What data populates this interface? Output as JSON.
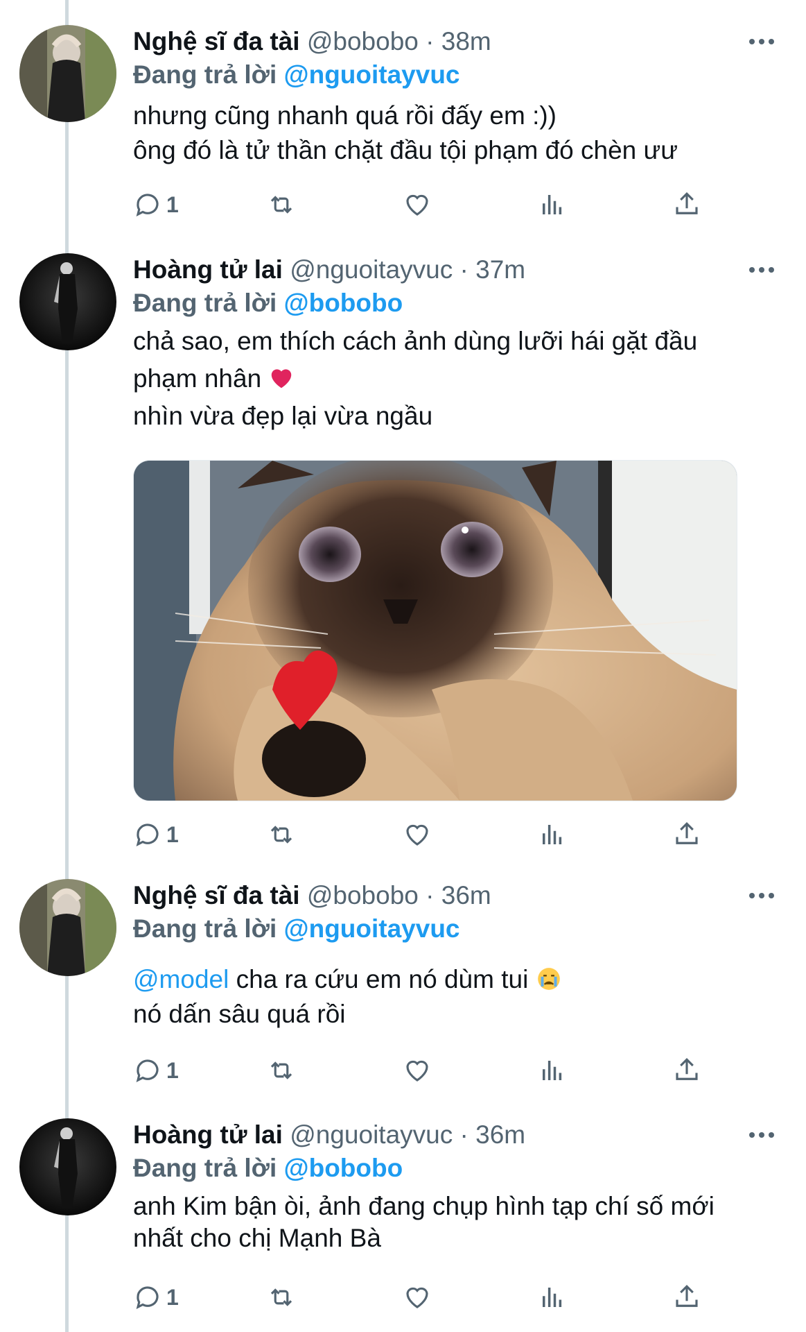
{
  "tweets": [
    {
      "name": "Nghệ sĩ đa tài",
      "handle": "@bobobo",
      "time": "38m",
      "reply_prefix": "Đang trả lời",
      "reply_to": "@nguoitayvuc",
      "lines": [
        "nhưng cũng nhanh quá rồi đấy em :))",
        "ông đó là tử thần chặt đầu tội phạm đó chèn ưư"
      ],
      "reply_count": "1"
    },
    {
      "name": "Hoàng tử lai",
      "handle": "@nguoitayvuc",
      "time": "37m",
      "reply_prefix": "Đang trả lời",
      "reply_to": "@bobobo",
      "lines": [
        "chả sao, em thích cách ảnh dùng lưỡi hái gặt đầu",
        "phạm nhân",
        "nhìn vừa đẹp lại vừa ngầu"
      ],
      "reply_count": "1"
    },
    {
      "name": "Nghệ sĩ đa tài",
      "handle": "@bobobo",
      "time": "36m",
      "reply_prefix": "Đang trả lời",
      "reply_to": "@nguoitayvuc",
      "mention": "@model",
      "lines": [
        "cha ra cứu em nó dùm tui",
        "nó dấn sâu quá rồi"
      ],
      "reply_count": "1"
    },
    {
      "name": "Hoàng tử lai",
      "handle": "@nguoitayvuc",
      "time": "36m",
      "reply_prefix": "Đang trả lời",
      "reply_to": "@bobobo",
      "lines": [
        "anh Kim bận òi, ảnh đang chụp hình tạp chí số mới",
        "nhất cho chị Mạnh Bà"
      ],
      "reply_count": "1"
    }
  ],
  "separator": "·",
  "colors": {
    "accent": "#1d9bf0",
    "muted": "#536471",
    "text": "#0f1419",
    "thread_line": "#cfd9de"
  },
  "icons": [
    "reply-icon",
    "retweet-icon",
    "like-icon",
    "views-icon",
    "share-icon",
    "more-icon",
    "heart-emoji",
    "crying-emoji"
  ]
}
